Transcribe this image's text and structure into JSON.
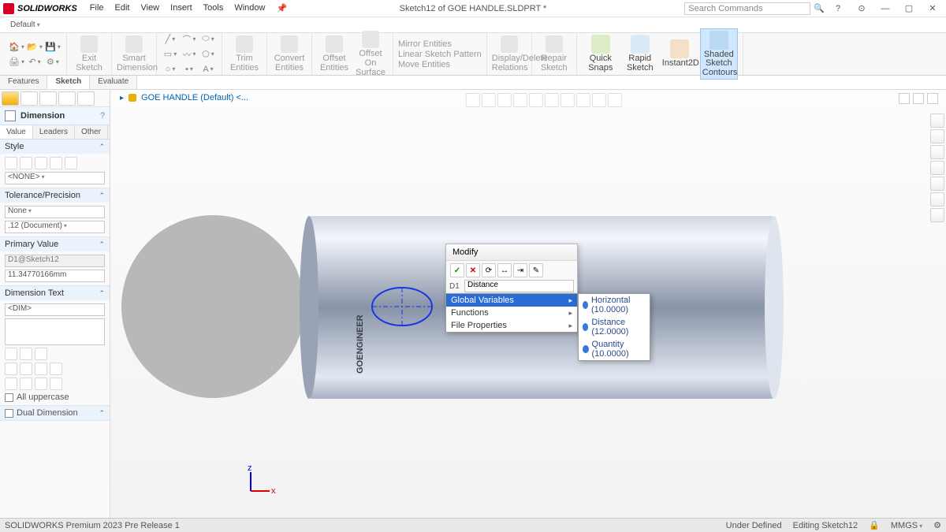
{
  "app": {
    "brand": "SOLIDWORKS",
    "doc_title": "Sketch12 of GOE HANDLE.SLDPRT *",
    "search_placeholder": "Search Commands"
  },
  "menus": {
    "file": "File",
    "edit": "Edit",
    "view": "View",
    "insert": "Insert",
    "tools": "Tools",
    "window": "Window"
  },
  "config": {
    "name": "Default"
  },
  "ribbon": {
    "exit_sketch": "Exit\nSketch",
    "smart_dim": "Smart\nDimension",
    "trim": "Trim\nEntities",
    "convert": "Convert\nEntities",
    "offset": "Offset\nEntities",
    "offset_surf": "Offset On\nSurface",
    "mirror": "Mirror Entities",
    "lsp": "Linear Sketch Pattern",
    "move": "Move Entities",
    "disp_del": "Display/Delete\nRelations",
    "repair": "Repair\nSketch",
    "quick": "Quick\nSnaps",
    "rapid": "Rapid\nSketch",
    "instant": "Instant2D",
    "shaded": "Shaded\nSketch\nContours"
  },
  "tabs": {
    "features": "Features",
    "sketch": "Sketch",
    "evaluate": "Evaluate"
  },
  "breadcrumb": {
    "root": "GOE HANDLE (Default) <..."
  },
  "property": {
    "title": "Dimension",
    "tabs": {
      "value": "Value",
      "leaders": "Leaders",
      "other": "Other"
    },
    "style_head": "Style",
    "style_value": "<NONE>",
    "tol_head": "Tolerance/Precision",
    "tol_type": "None",
    "tol_prec": ".12 (Document)",
    "pv_head": "Primary Value",
    "pv_name": "D1@Sketch12",
    "pv_value": "11.34770166mm",
    "dt_head": "Dimension Text",
    "dt_token": "<DIM>",
    "uppercase": "All uppercase",
    "dual": "Dual Dimension"
  },
  "modify": {
    "title": "Modify",
    "param": "D1",
    "field_label": "Distance",
    "menu": {
      "gv": "Global Variables",
      "fn": "Functions",
      "fp": "File Properties"
    },
    "sub": {
      "h": "Horizontal (10.0000)",
      "d": "Distance (12.0000)",
      "q": "Quantity (10.0000)"
    }
  },
  "status": {
    "product": "SOLIDWORKS Premium 2023 Pre Release 1",
    "under": "Under Defined",
    "editing": "Editing Sketch12",
    "units": "MMGS"
  },
  "model_text": "GOENGINEER"
}
